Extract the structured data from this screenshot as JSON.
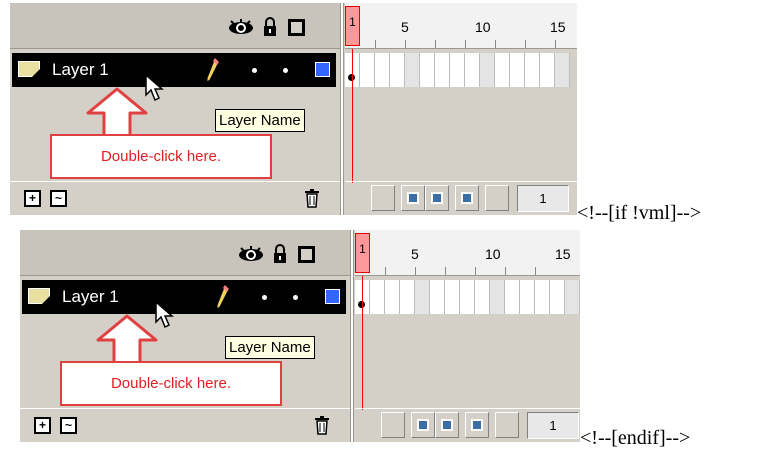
{
  "screenshots": [
    {
      "layer_name": "Layer 1",
      "tooltip": "Layer Name",
      "callout": "Double-click here.",
      "ruler": {
        "playhead": "1",
        "labels": [
          "5",
          "10",
          "15"
        ]
      },
      "frame_field": "1"
    },
    {
      "layer_name": "Layer 1",
      "tooltip": "Layer Name",
      "callout": "Double-click here.",
      "ruler": {
        "playhead": "1",
        "labels": [
          "5",
          "10",
          "15"
        ]
      },
      "frame_field": "1"
    }
  ],
  "markup_comments": [
    "<!--[if !vml]-->",
    "<!--[endif]-->"
  ],
  "icons": [
    "eye-icon",
    "lock-icon",
    "outline-icon",
    "layer-icon",
    "pencil-icon",
    "cursor-icon",
    "trash-icon",
    "insert-layer-icon",
    "motion-guide-icon"
  ],
  "colors": {
    "callout_border": "#e04040",
    "callout_text": "#e02020",
    "layer_color": "#3366ff",
    "playhead": "#ff9999"
  }
}
